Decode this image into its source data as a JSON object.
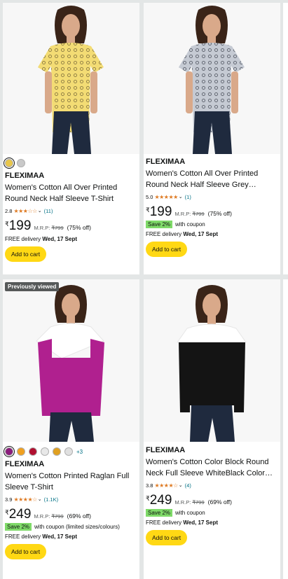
{
  "products": [
    {
      "brand": "FLEXIMAA",
      "title": "Women's Cotton All Over Printed Round Neck Half Sleeve T-Shirt",
      "rating": "2.8",
      "stars": "★★★☆☆",
      "rating_count": "(11)",
      "currency": "₹",
      "price": "199",
      "mrp_label": "M.R.P:",
      "mrp": "₹799",
      "discount": "(75% off)",
      "delivery_label": "FREE delivery",
      "delivery_date": "Wed, 17 Sept",
      "cart_label": "Add to cart",
      "swatches": [
        {
          "icon": "yellow-print-swatch",
          "color": "#e8c64a",
          "selected": true
        },
        {
          "icon": "grey-print-swatch",
          "color": "#c9c9c9",
          "selected": false
        }
      ]
    },
    {
      "brand": "FLEXIMAA",
      "title": "Women's Cotton All Over Printed Round Neck Half Sleeve Grey Melan…",
      "rating": "5.0",
      "stars": "★★★★★",
      "rating_count": "(1)",
      "currency": "₹",
      "price": "199",
      "mrp_label": "M.R.P:",
      "mrp": "₹799",
      "discount": "(75% off)",
      "save_label": "Save 2%",
      "save_text": "with coupon",
      "delivery_label": "FREE delivery",
      "delivery_date": "Wed, 17 Sept",
      "cart_label": "Add to cart"
    },
    {
      "badge": "Previously viewed",
      "brand": "FLEXIMAA",
      "title": "Women's Cotton Printed Raglan Full Sleeve T-Shirt",
      "rating": "3.9",
      "stars": "★★★★☆",
      "rating_count": "(1.1K)",
      "currency": "₹",
      "price": "249",
      "mrp_label": "M.R.P:",
      "mrp": "₹799",
      "discount": "(69% off)",
      "save_label": "Save 2%",
      "save_text": "with coupon (limited sizes/colours)",
      "delivery_label": "FREE delivery",
      "delivery_date": "Wed, 17 Sept",
      "cart_label": "Add to cart",
      "swatches": [
        {
          "icon": "purple-swatch",
          "color": "#8a1c7c",
          "selected": true
        },
        {
          "icon": "orange-swatch",
          "color": "#f0a020",
          "selected": false
        },
        {
          "icon": "maroon-swatch",
          "color": "#b01030",
          "selected": false
        },
        {
          "icon": "white-swatch",
          "color": "#e8e8e8",
          "selected": false
        },
        {
          "icon": "mustard-swatch",
          "color": "#e0a020",
          "selected": false
        },
        {
          "icon": "light-grey-swatch",
          "color": "#e0e0e0",
          "selected": false
        }
      ],
      "more_swatches": "+3"
    },
    {
      "brand": "FLEXIMAA",
      "title": "Women's Cotton Color Block Round Neck Full Sleeve WhiteBlack Color T…",
      "rating": "3.8",
      "stars": "★★★★☆",
      "rating_count": "(4)",
      "currency": "₹",
      "price": "249",
      "mrp_label": "M.R.P:",
      "mrp": "₹799",
      "discount": "(69% off)",
      "save_label": "Save 2%",
      "save_text": "with coupon",
      "delivery_label": "FREE delivery",
      "delivery_date": "Wed, 17 Sept",
      "cart_label": "Add to cart"
    }
  ],
  "colors": {
    "cart_button": "#ffd814",
    "stars": "#de7921",
    "link": "#007185",
    "save_pill": "#7fda69",
    "badge": "#565959"
  }
}
